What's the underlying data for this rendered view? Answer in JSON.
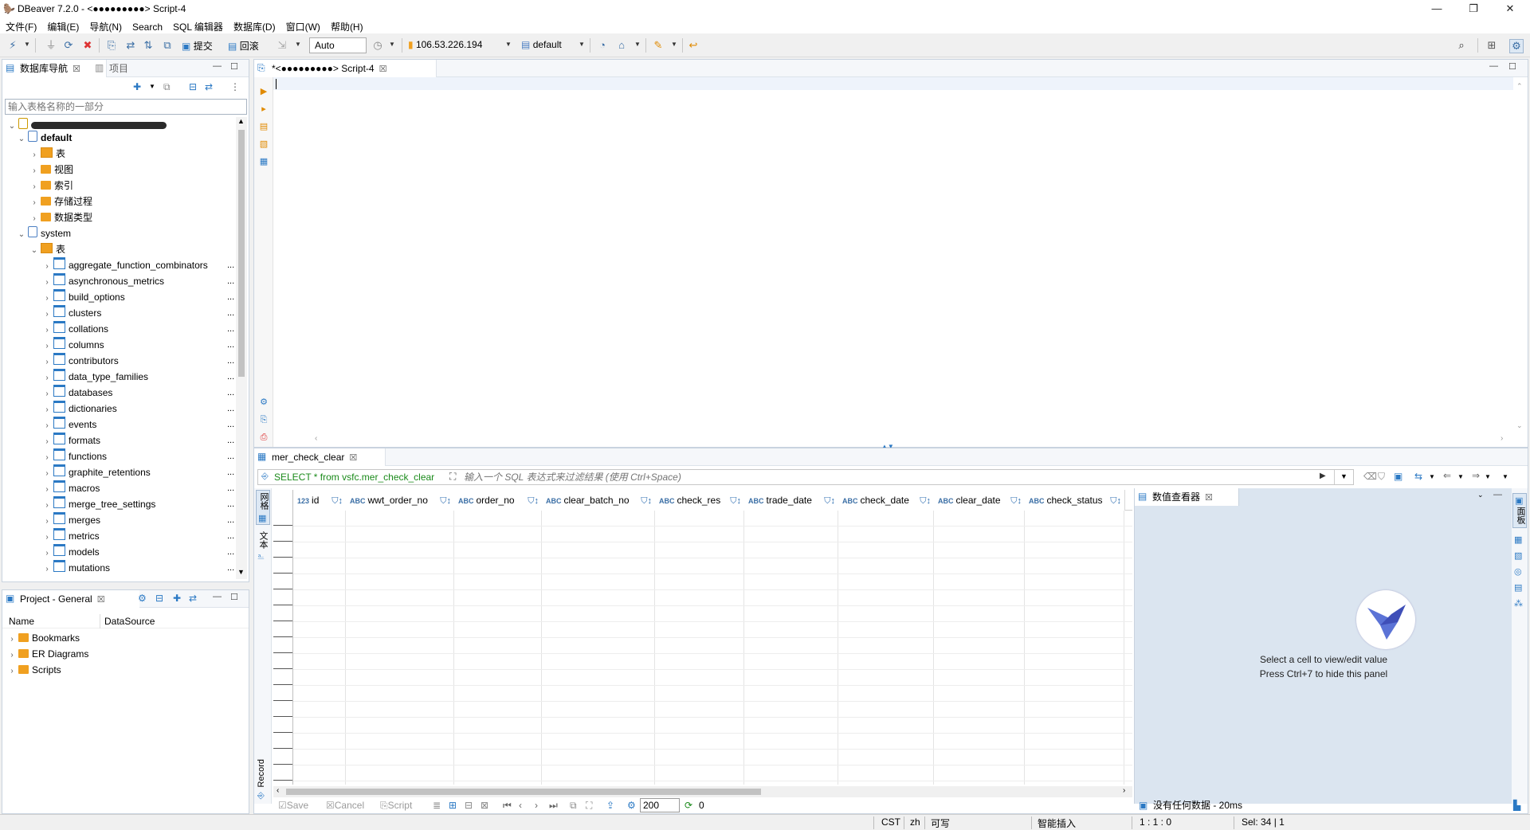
{
  "window": {
    "title": "DBeaver 7.2.0 - <●●●●●●●●●> Script-4"
  },
  "menu": [
    "文件(F)",
    "编辑(E)",
    "导航(N)",
    "Search",
    "SQL 编辑器",
    "数据库(D)",
    "窗口(W)",
    "帮助(H)"
  ],
  "toolbar": {
    "commit_label": "提交",
    "rollback_label": "回滚",
    "tx_mode": "Auto",
    "host": "106.53.226.194",
    "schema": "default"
  },
  "navigator": {
    "tab_label": "数据库导航",
    "project_tab_label": "项目",
    "filter_placeholder": "输入表格名称的一部分",
    "tree": [
      {
        "label": "default",
        "bold": true,
        "level": 1,
        "expanded": true,
        "icon": "database-icon"
      },
      {
        "label": "表",
        "level": 2,
        "icon": "tables-folder-icon"
      },
      {
        "label": "视图",
        "level": 2,
        "icon": "views-folder-icon"
      },
      {
        "label": "索引",
        "level": 2,
        "icon": "folder-icon"
      },
      {
        "label": "存储过程",
        "level": 2,
        "icon": "folder-icon"
      },
      {
        "label": "数据类型",
        "level": 2,
        "icon": "folder-icon"
      },
      {
        "label": "system",
        "level": 1,
        "expanded": true,
        "icon": "database-icon"
      },
      {
        "label": "表",
        "level": 2,
        "expanded": true,
        "icon": "tables-folder-icon"
      },
      {
        "label": "aggregate_function_combinators",
        "level": 3,
        "icon": "table-icon"
      },
      {
        "label": "asynchronous_metrics",
        "level": 3,
        "icon": "table-icon"
      },
      {
        "label": "build_options",
        "level": 3,
        "icon": "table-icon"
      },
      {
        "label": "clusters",
        "level": 3,
        "icon": "table-icon"
      },
      {
        "label": "collations",
        "level": 3,
        "icon": "table-icon"
      },
      {
        "label": "columns",
        "level": 3,
        "icon": "table-icon"
      },
      {
        "label": "contributors",
        "level": 3,
        "icon": "table-icon"
      },
      {
        "label": "data_type_families",
        "level": 3,
        "icon": "table-icon"
      },
      {
        "label": "databases",
        "level": 3,
        "icon": "table-icon"
      },
      {
        "label": "dictionaries",
        "level": 3,
        "icon": "table-icon"
      },
      {
        "label": "events",
        "level": 3,
        "icon": "table-icon"
      },
      {
        "label": "formats",
        "level": 3,
        "icon": "table-icon"
      },
      {
        "label": "functions",
        "level": 3,
        "icon": "table-icon"
      },
      {
        "label": "graphite_retentions",
        "level": 3,
        "icon": "table-icon"
      },
      {
        "label": "macros",
        "level": 3,
        "icon": "table-icon"
      },
      {
        "label": "merge_tree_settings",
        "level": 3,
        "icon": "table-icon"
      },
      {
        "label": "merges",
        "level": 3,
        "icon": "table-icon"
      },
      {
        "label": "metrics",
        "level": 3,
        "icon": "table-icon"
      },
      {
        "label": "models",
        "level": 3,
        "icon": "table-icon"
      },
      {
        "label": "mutations",
        "level": 3,
        "icon": "table-icon"
      }
    ],
    "row_ellipsis": "..."
  },
  "project": {
    "tab_label": "Project - General",
    "col_name": "Name",
    "col_datasource": "DataSource",
    "items": [
      "Bookmarks",
      "ER Diagrams",
      "Scripts"
    ]
  },
  "editor": {
    "tab_label": "<●●●●●●●●●> Script-4",
    "tab_dirty_prefix": "*",
    "content": ""
  },
  "results": {
    "tab_label": "mer_check_clear",
    "query": "SELECT * from vsfc.mer_check_clear",
    "filter_placeholder": "输入一个 SQL 表达式来过滤结果 (使用 Ctrl+Space)",
    "side_grid_label": "网格",
    "side_text_label": "文本",
    "side_record_label": "Record",
    "columns": [
      {
        "name": "id",
        "type": "123"
      },
      {
        "name": "wwt_order_no",
        "type": "ABC"
      },
      {
        "name": "order_no",
        "type": "ABC"
      },
      {
        "name": "clear_batch_no",
        "type": "ABC"
      },
      {
        "name": "check_res",
        "type": "ABC"
      },
      {
        "name": "trade_date",
        "type": "ABC"
      },
      {
        "name": "check_date",
        "type": "ABC"
      },
      {
        "name": "clear_date",
        "type": "ABC"
      },
      {
        "name": "check_status",
        "type": "ABC"
      }
    ],
    "value_viewer": {
      "tab_label": "数值查看器",
      "hint1": "Select a cell to view/edit value",
      "hint2": "Press Ctrl+7 to hide this panel",
      "side_label": "面板"
    },
    "bottom": {
      "save": "Save",
      "cancel": "Cancel",
      "script": "Script",
      "fetch_size": "200",
      "refresh_count": "0",
      "status": "没有任何数据 - 20ms"
    }
  },
  "statusbar": {
    "tz": "CST",
    "locale": "zh",
    "mode": "可写",
    "insert": "智能插入",
    "pos": "1 : 1 : 0",
    "sel": "Sel: 34 | 1"
  },
  "colors": {
    "accent": "#2b79c4",
    "folder": "#f0a020",
    "panel_border": "#c9d3df",
    "query_green": "#1a8a1a"
  }
}
